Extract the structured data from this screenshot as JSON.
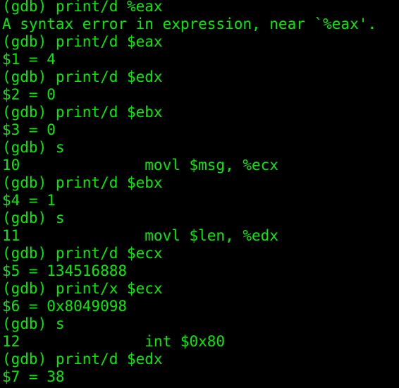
{
  "terminal": {
    "text_color": "#00ee00",
    "background_color": "#000000",
    "lines": [
      "(gdb) print/d %eax",
      "A syntax error in expression, near `%eax'.",
      "(gdb) print/d $eax",
      "$1 = 4",
      "(gdb) print/d $edx",
      "$2 = 0",
      "(gdb) print/d $ebx",
      "$3 = 0",
      "(gdb) s",
      "10              movl $msg, %ecx",
      "(gdb) print/d $ebx",
      "$4 = 1",
      "(gdb) s",
      "11              movl $len, %edx",
      "(gdb) print/d $ecx",
      "$5 = 134516888",
      "(gdb) print/x $ecx",
      "$6 = 0x8049098",
      "(gdb) s",
      "12              int $0x80",
      "(gdb) print/d $edx",
      "$7 = 38"
    ]
  }
}
